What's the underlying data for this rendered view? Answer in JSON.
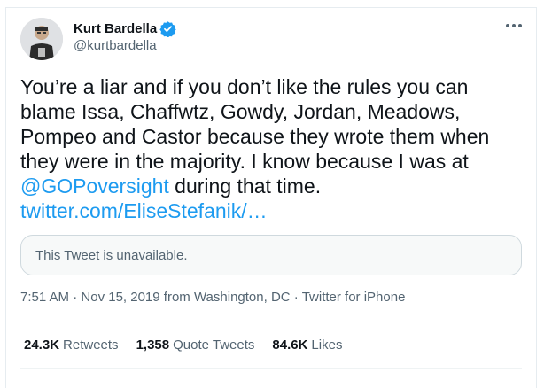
{
  "author": {
    "display_name": "Kurt Bardella",
    "handle": "@kurtbardella",
    "verified": true
  },
  "tweet": {
    "text_lines": [
      "You’re a liar and if you don’t like the rules you can",
      "blame Issa, Chaffwtz, Gowdy, Jordan, Meadows,",
      "Pompeo and Castor because they wrote them when",
      "they were in the majority. I know because I was at"
    ],
    "mention": "@GOPoversight",
    "after_mention": " during that time.",
    "link": "twitter.com/EliseStefanik/…"
  },
  "quoted_tweet": {
    "unavailable_text": "This Tweet is unavailable."
  },
  "meta": {
    "time": "7:51 AM",
    "separator": " · ",
    "date": "Nov 15, 2019",
    "location": " from Washington, DC",
    "source": "Twitter for iPhone"
  },
  "stats": {
    "retweets_count": "24.3K",
    "retweets_label": "Retweets",
    "quotes_count": "1,358",
    "quotes_label": "Quote Tweets",
    "likes_count": "84.6K",
    "likes_label": "Likes"
  },
  "icons": {
    "verified": "verified-badge-icon",
    "more": "more-options-icon"
  },
  "colors": {
    "link": "#1d9bf0",
    "verified": "#1d9bf0",
    "secondary_text": "#536471"
  }
}
